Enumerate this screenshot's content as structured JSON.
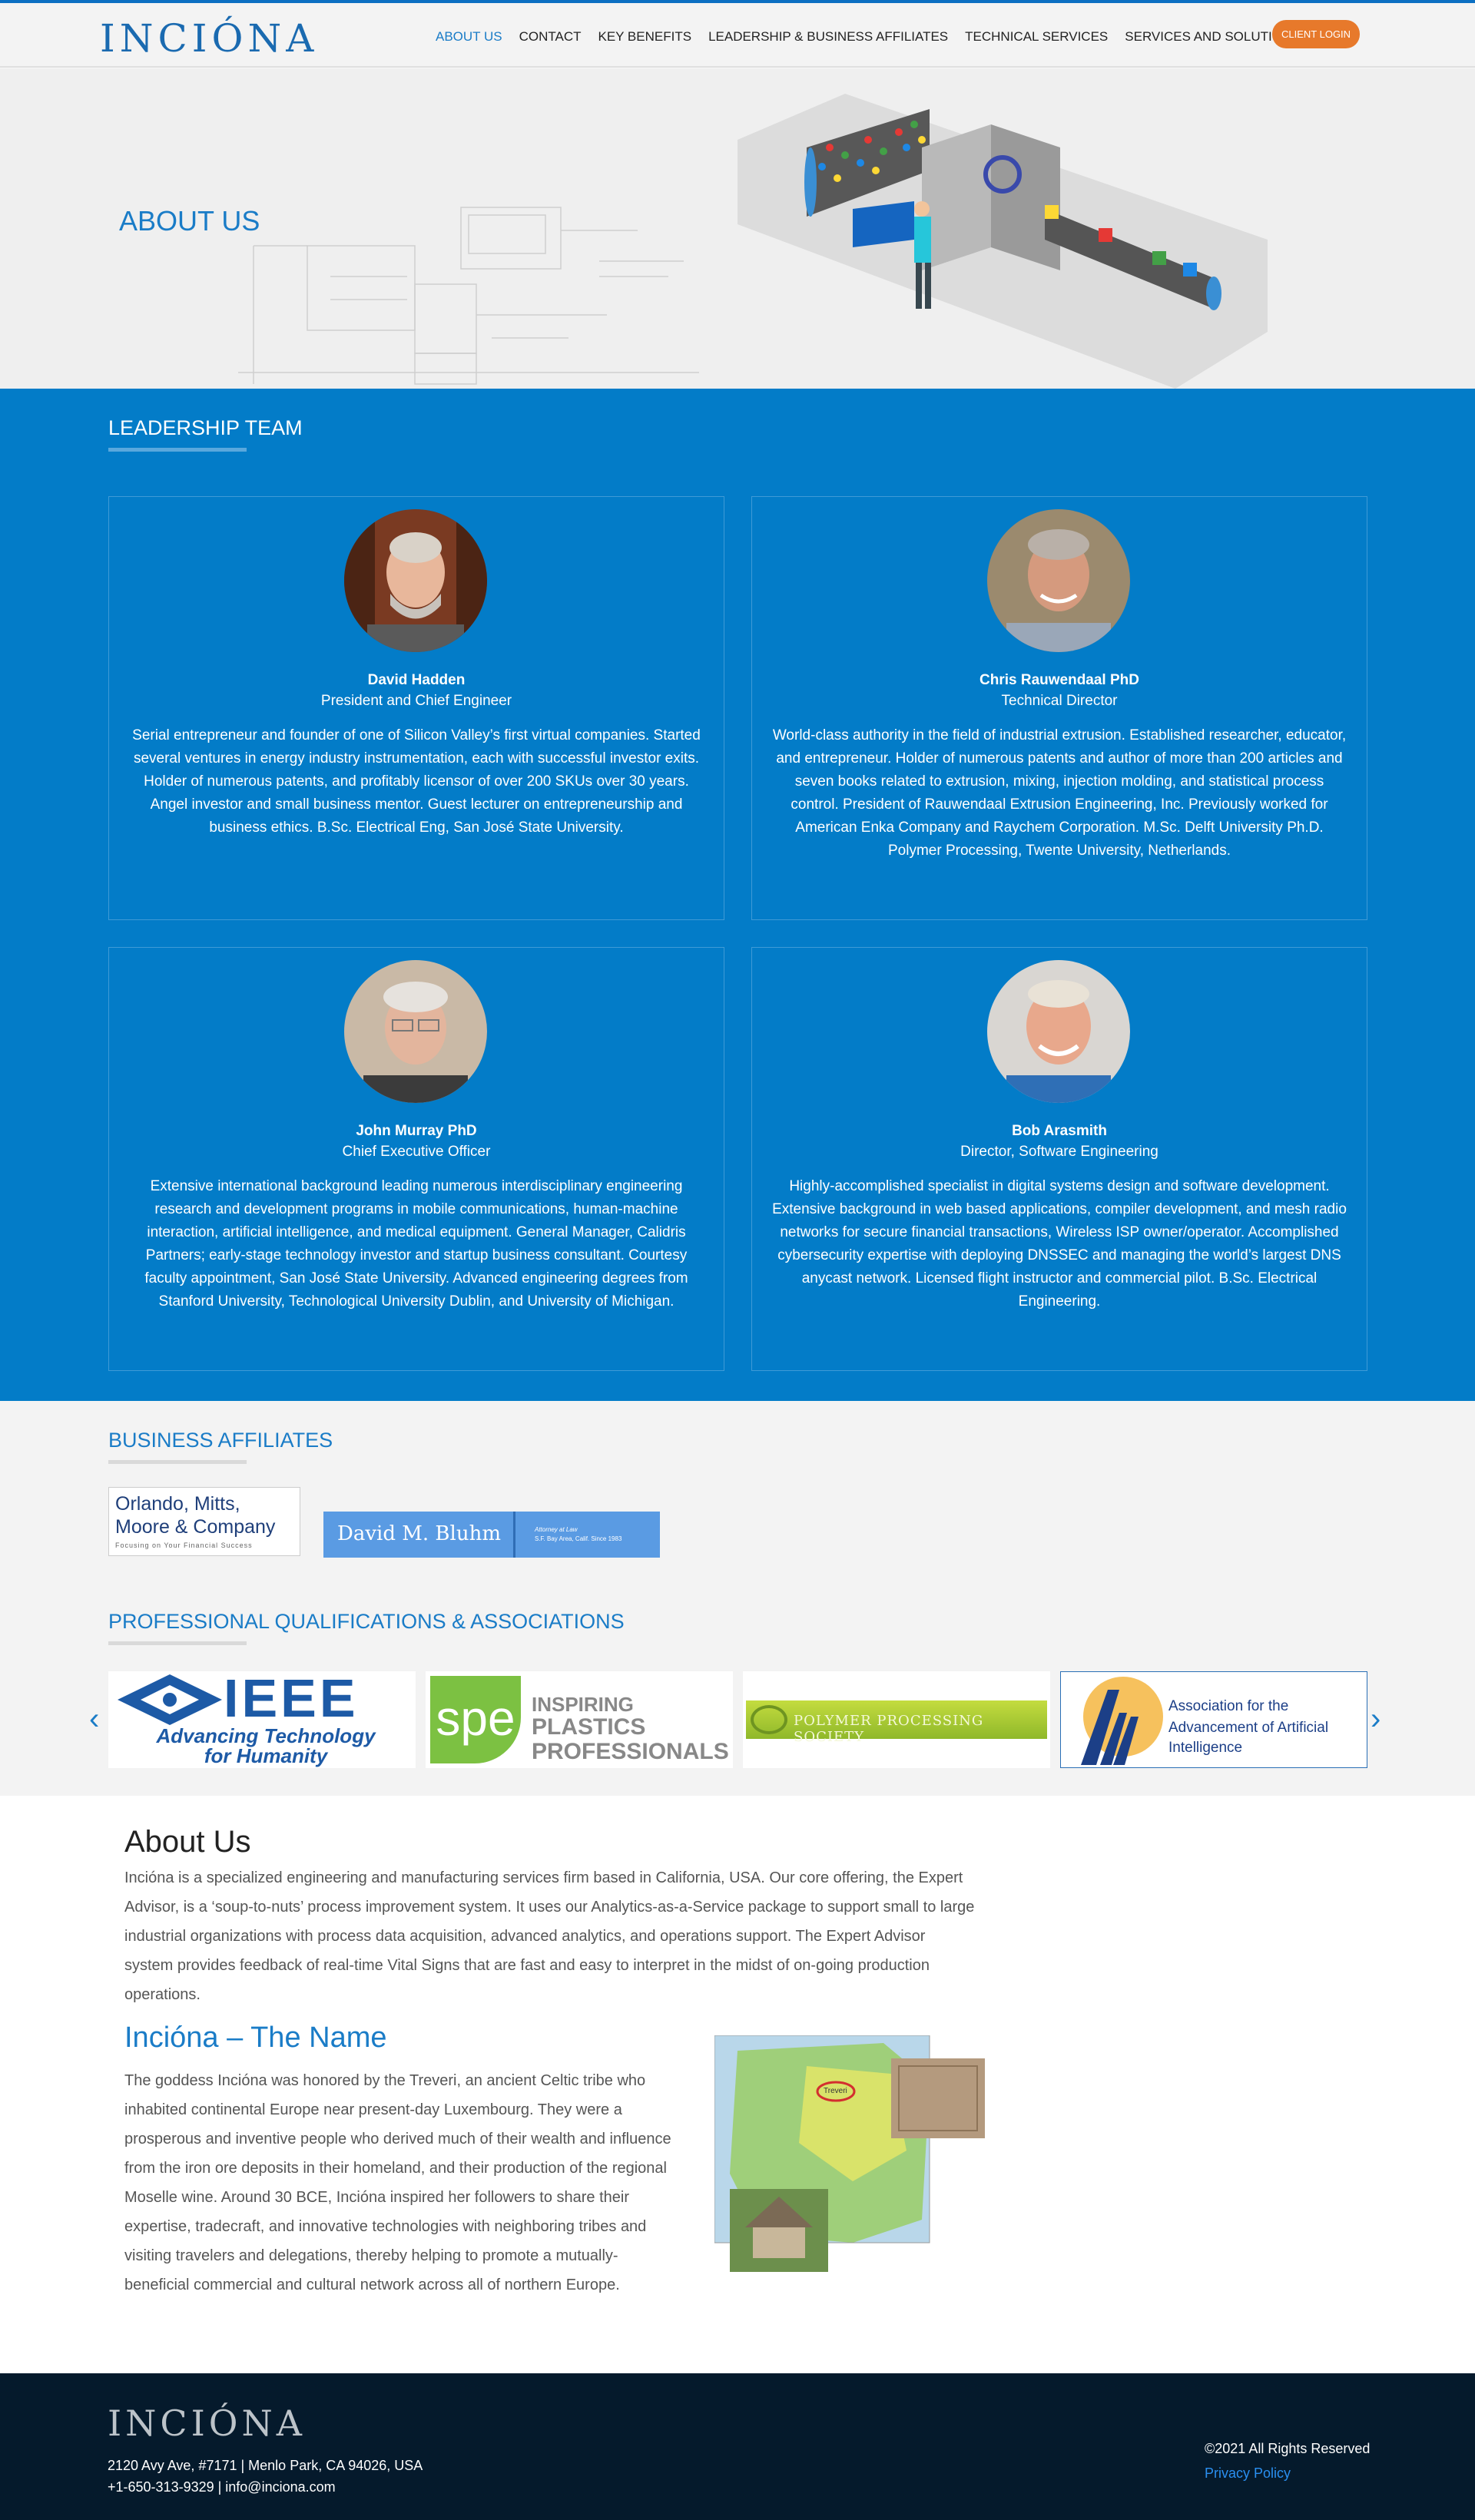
{
  "brand": {
    "logo": "INCIÓNA",
    "accent": "#037cc8",
    "orange": "#e7792b"
  },
  "nav": {
    "items": [
      "About Us",
      "Contact",
      "Key Benefits",
      "Leadership & Business Affiliates",
      "Technical Services",
      "Services and Solutions"
    ],
    "client_login": "CLIENT LOGIN"
  },
  "hero": {
    "title": "ABOUT US"
  },
  "leadership": {
    "title": "LEADERSHIP TEAM",
    "people": [
      {
        "name": "David Hadden",
        "title": "President and Chief Engineer",
        "bio": "Serial entrepreneur and founder of one of Silicon Valley’s first virtual companies. Started several ventures in energy industry instrumentation, each with successful investor exits. Holder of numerous patents, and profitably licensor of over 200 SKUs over 30 years. Angel investor and small business mentor. Guest lecturer on entrepreneurship and business ethics. B.Sc. Electrical Eng, San José State University."
      },
      {
        "name": "Chris Rauwendaal PhD",
        "title": "Technical Director",
        "bio": "World-class authority in the field of industrial extrusion. Established researcher, educator, and entrepreneur. Holder of numerous patents and author of more than 200 articles and seven books related to extrusion, mixing, injection molding, and statistical process control. President of Rauwendaal Extrusion Engineering, Inc. Previously worked for American Enka Company and Raychem Corporation. M.Sc. Delft University Ph.D. Polymer Processing, Twente University, Netherlands."
      },
      {
        "name": "John Murray PhD",
        "title": "Chief Executive Officer",
        "bio": "Extensive international background leading numerous interdisciplinary engineering research and development programs in mobile communications, human-machine interaction, artificial intelligence, and medical equipment. General Manager, Calidris Partners; early-stage technology investor and startup business consultant. Courtesy faculty appointment, San José State University. Advanced engineering degrees from Stanford University, Technological University Dublin, and University of Michigan."
      },
      {
        "name": "Bob Arasmith",
        "title": "Director, Software Engineering",
        "bio": "Highly-accomplished specialist in digital systems design and software development. Extensive background in web based applications, compiler development, and mesh radio networks for secure financial transactions, Wireless ISP owner/operator. Accomplished cybersecurity expertise with deploying DNSSEC and managing the world’s largest DNS anycast network. Licensed flight instructor and commercial pilot. B.Sc. Electrical Engineering."
      }
    ]
  },
  "affiliates": {
    "title": "BUSINESS AFFILIATES",
    "omm": {
      "line1": "Orlando, Mitts,",
      "line2": "Moore & Company",
      "tagline": "Focusing on Your Financial Success"
    },
    "bluhm": {
      "name": "David M. Bluhm",
      "line1": "Attorney at Law",
      "line2": "S.F. Bay Area, Calif. Since 1983"
    }
  },
  "quals": {
    "title": "PROFESSIONAL QUALIFICATIONS & ASSOCIATIONS",
    "ieee": {
      "word": "IEEE",
      "tag1": "Advancing Technology",
      "tag2": "for Humanity"
    },
    "spe": {
      "mark": "spe",
      "line1": "INSPIRING",
      "line2": "PLASTICS",
      "line3": "PROFESSIONALS"
    },
    "pps": {
      "text": "POLYMER PROCESSING SOCIETY"
    },
    "aaai": {
      "line1": "Association for the",
      "line2": "Advancement of Artificial Intelligence"
    },
    "prev": "‹",
    "next": "›"
  },
  "about": {
    "heading": "About Us",
    "body": "Incióna is a specialized engineering and manufacturing services firm based in California, USA. Our core offering, the Expert Advisor, is a ‘soup-to-nuts’ process improvement system. It uses our Analytics-as-a-Service package to support small to large industrial organizations with process data acquisition, advanced analytics, and operations support. The Expert Advisor system provides feedback of real-time Vital Signs that are fast and easy to interpret in the midst of on-going production operations.",
    "name_heading": "Incióna – The Name",
    "name_body": "The goddess Incióna was honored by the Treveri, an ancient Celtic tribe who inhabited continental Europe near present-day Luxembourg. They were a prosperous and inventive people who derived much of their wealth and influence from the iron ore deposits in their homeland, and their production of the regional Moselle wine. Around 30 BCE, Incióna inspired her followers to share their expertise, tradecraft, and innovative technologies with neighboring tribes and visiting travelers and delegations, thereby helping to promote a mutually-beneficial commercial and cultural network across all of northern Europe.",
    "map_label": "Treveri"
  },
  "footer": {
    "logo": "INCIÓNA",
    "address": "2120 Avy Ave, #7171 | Menlo Park, CA 94026, USA",
    "contact": "+1-650-313-9329 | info@inciona.com",
    "copyright": "©2021 All Rights Reserved",
    "privacy": "Privacy Policy"
  }
}
